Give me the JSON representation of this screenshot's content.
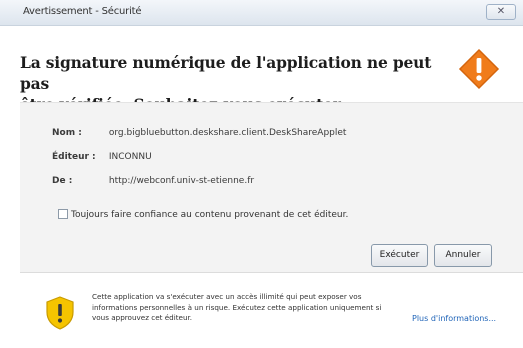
{
  "window": {
    "title": "Avertissement - Sécurité",
    "close_glyph": "✕"
  },
  "header": {
    "headline_line1": "La signature numérique de l'application ne peut pas",
    "headline_line2": "être vérifiée.  Souhaitez-vous exécuter l'application ?",
    "icon": "warning-diamond-icon",
    "icon_color": "#f07c1b"
  },
  "details": {
    "name_label": "Nom :",
    "name_value": "org.bigbluebutton.deskshare.client.DeskShareApplet",
    "publisher_label": "Éditeur :",
    "publisher_value": "INCONNU",
    "from_label": "De :",
    "from_value": "http://webconf.univ-st-etienne.fr"
  },
  "trust_checkbox": {
    "label": "Toujours faire confiance au contenu provenant de cet éditeur.",
    "checked": false
  },
  "buttons": {
    "run": "Exécuter",
    "cancel": "Annuler"
  },
  "footer": {
    "icon": "shield-warning-icon",
    "text": "Cette application va s'exécuter avec un accès illimité qui peut exposer vos informations personnelles à un risque. Exécutez cette application uniquement si vous approuvez cet éditeur.",
    "more_link": "Plus d'informations..."
  }
}
